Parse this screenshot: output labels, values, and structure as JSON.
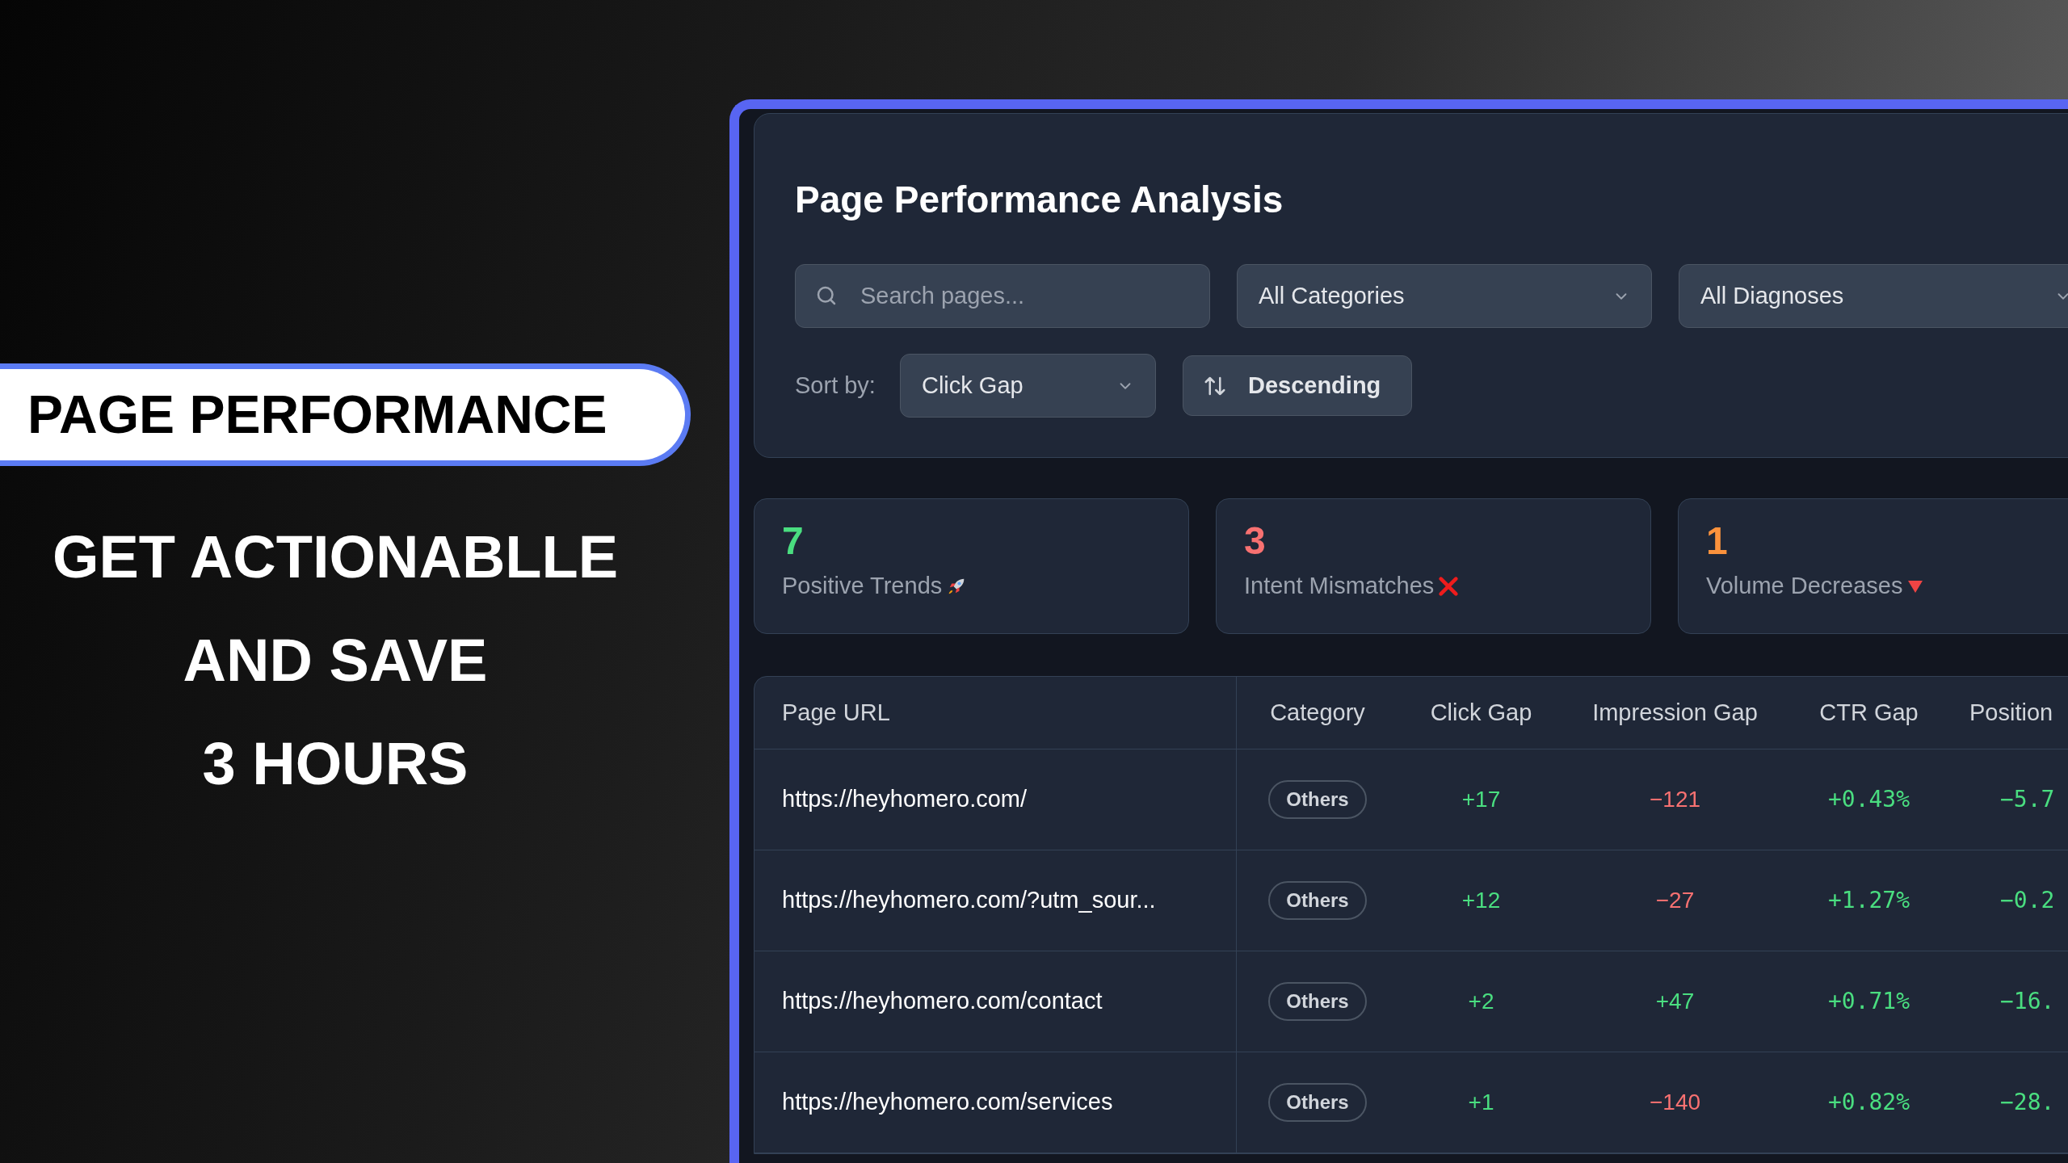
{
  "banner": {
    "label": "PAGE PERFORMANCE",
    "headline": [
      "GET ACTIONABLLE",
      "AND SAVE",
      "3 HOURS"
    ]
  },
  "app": {
    "title": "Page Performance Analysis",
    "search": {
      "placeholder": "Search pages..."
    },
    "filters": [
      "All Categories",
      "All Diagnoses"
    ],
    "sort": {
      "label": "Sort by:",
      "value": "Click Gap",
      "order": "Descending"
    },
    "stats": [
      {
        "value": "7",
        "label": "Positive Trends",
        "color": "#4ade80",
        "kind": "rocket"
      },
      {
        "value": "3",
        "label": "Intent Mismatches",
        "color": "#f87171",
        "kind": "cross"
      },
      {
        "value": "1",
        "label": "Volume Decreases",
        "color": "#fb923c",
        "kind": "down"
      }
    ],
    "table": {
      "columns": [
        "Page URL",
        "Category",
        "Click Gap",
        "Impression Gap",
        "CTR Gap",
        "Position"
      ],
      "rows": [
        {
          "url": "https://heyhomero.com/",
          "category": "Others",
          "gaps": [
            {
              "text": "+17",
              "color": "#4ade80"
            },
            {
              "text": "−121",
              "color": "#f87171"
            },
            {
              "text": "+0.43%",
              "color": "#4ade80"
            },
            {
              "text": "−5.7",
              "color": "#4ade80"
            }
          ]
        },
        {
          "url": "https://heyhomero.com/?utm_sour...",
          "category": "Others",
          "gaps": [
            {
              "text": "+12",
              "color": "#4ade80"
            },
            {
              "text": "−27",
              "color": "#f87171"
            },
            {
              "text": "+1.27%",
              "color": "#4ade80"
            },
            {
              "text": "−0.2",
              "color": "#4ade80"
            }
          ]
        },
        {
          "url": "https://heyhomero.com/contact",
          "category": "Others",
          "gaps": [
            {
              "text": "+2",
              "color": "#4ade80"
            },
            {
              "text": "+47",
              "color": "#4ade80"
            },
            {
              "text": "+0.71%",
              "color": "#4ade80"
            },
            {
              "text": "−16.",
              "color": "#4ade80"
            }
          ]
        },
        {
          "url": "https://heyhomero.com/services",
          "category": "Others",
          "gaps": [
            {
              "text": "+1",
              "color": "#4ade80"
            },
            {
              "text": "−140",
              "color": "#f87171"
            },
            {
              "text": "+0.82%",
              "color": "#4ade80"
            },
            {
              "text": "−28.",
              "color": "#4ade80"
            }
          ]
        }
      ]
    }
  }
}
